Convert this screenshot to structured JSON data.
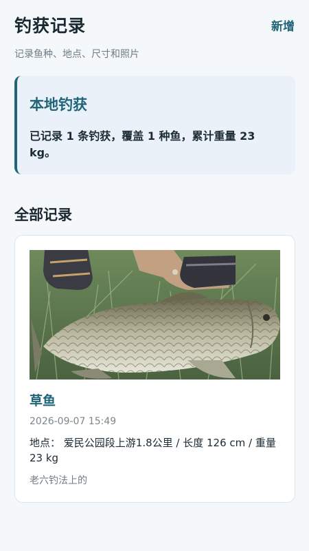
{
  "header": {
    "title": "钓获记录",
    "add_label": "新增",
    "subtitle": "记录鱼种、地点、尺寸和照片"
  },
  "summary": {
    "title": "本地钓获",
    "text": "已记录 1 条钓获，覆盖 1 种鱼，累计重量 23 kg。"
  },
  "records_section": {
    "title": "全部记录",
    "items": [
      {
        "fish": "草鱼",
        "time": "2026-09-07 15:49",
        "detail": "地点：  爱民公园段上游1.8公里 / 长度 126 cm / 重量 23 kg",
        "note": "老六钓法上的"
      }
    ]
  },
  "colors": {
    "accent": "#1f6479",
    "summary_bg": "#eaf1f8",
    "page_bg": "#f4f8fb"
  }
}
